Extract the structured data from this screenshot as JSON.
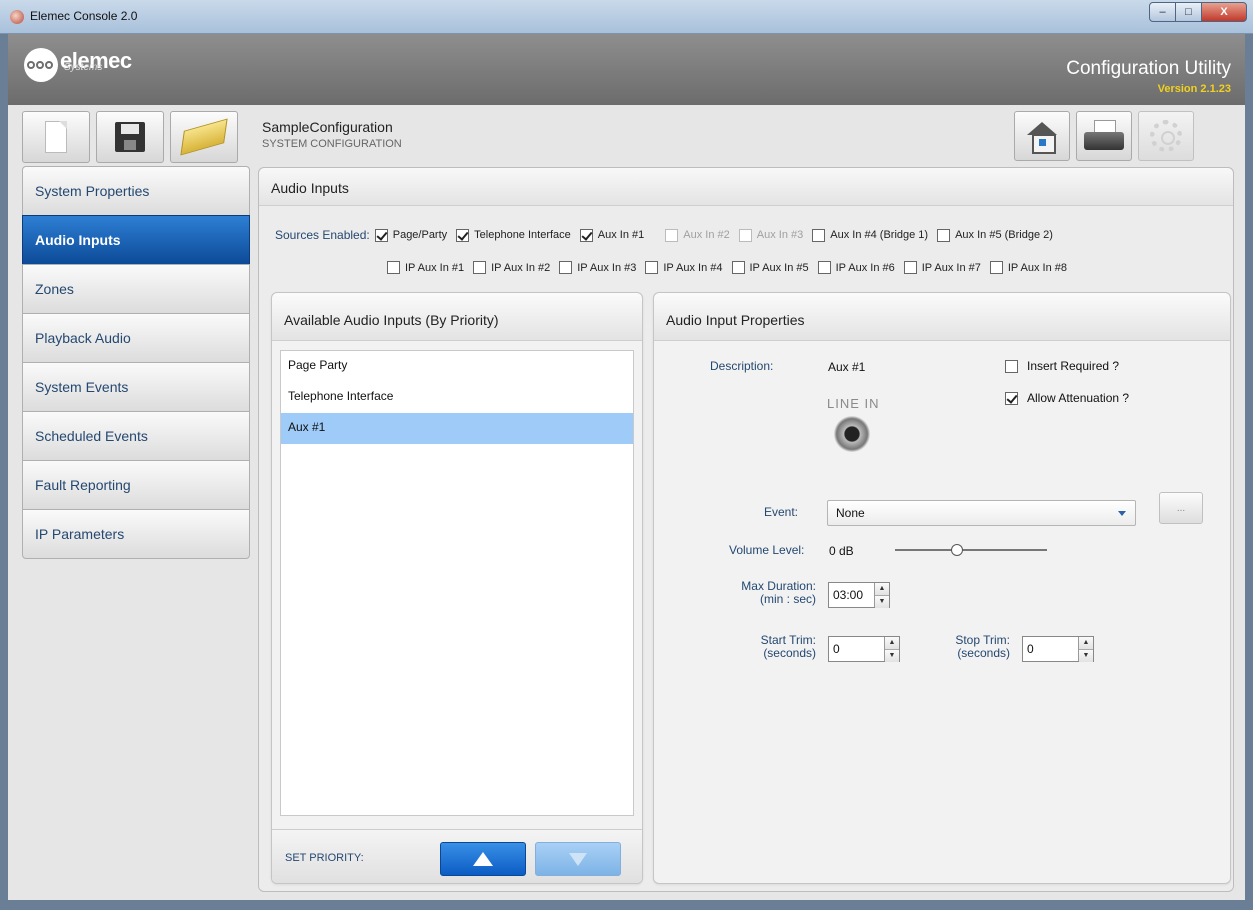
{
  "window": {
    "title": "Elemec Console 2.0",
    "controls": {
      "minimize": "–",
      "maximize": "□",
      "close": "X"
    }
  },
  "banner": {
    "logo_text": "elemec",
    "logo_sub": "Systems",
    "title": "Configuration Utility",
    "version": "Version 2.1.23"
  },
  "toolbar": {
    "left_buttons": [
      "new-document-icon",
      "save-icon",
      "open-folder-icon"
    ],
    "right_buttons": [
      "home-icon",
      "printer-icon",
      "gear-icon"
    ]
  },
  "config": {
    "name": "SampleConfiguration",
    "subtitle": "SYSTEM CONFIGURATION"
  },
  "sidebar": {
    "items": [
      {
        "label": "System Properties",
        "active": false
      },
      {
        "label": "Audio Inputs",
        "active": true
      },
      {
        "label": "Zones",
        "active": false
      },
      {
        "label": "Playback Audio",
        "active": false
      },
      {
        "label": "System Events",
        "active": false
      },
      {
        "label": "Scheduled Events",
        "active": false
      },
      {
        "label": "Fault Reporting",
        "active": false
      },
      {
        "label": "IP Parameters",
        "active": false
      }
    ]
  },
  "main": {
    "title": "Audio Inputs",
    "sources_label": "Sources Enabled:",
    "sources_row1": [
      {
        "label": "Page/Party",
        "checked": true,
        "enabled": true
      },
      {
        "label": "Telephone Interface",
        "checked": true,
        "enabled": true
      },
      {
        "label": "Aux In #1",
        "checked": true,
        "enabled": true
      },
      {
        "label": "Aux In #2",
        "checked": false,
        "enabled": false
      },
      {
        "label": "Aux In #3",
        "checked": false,
        "enabled": false
      },
      {
        "label": "Aux In #4 (Bridge 1)",
        "checked": false,
        "enabled": true
      },
      {
        "label": "Aux In #5 (Bridge 2)",
        "checked": false,
        "enabled": true
      }
    ],
    "sources_row2": [
      {
        "label": "IP Aux In #1",
        "checked": false
      },
      {
        "label": "IP Aux In #2",
        "checked": false
      },
      {
        "label": "IP Aux In #3",
        "checked": false
      },
      {
        "label": "IP Aux In #4",
        "checked": false
      },
      {
        "label": "IP Aux In #5",
        "checked": false
      },
      {
        "label": "IP Aux In #6",
        "checked": false
      },
      {
        "label": "IP Aux In #7",
        "checked": false
      },
      {
        "label": "IP Aux In #8",
        "checked": false
      }
    ]
  },
  "inputs_panel": {
    "title": "Available Audio Inputs (By Priority)",
    "items": [
      {
        "label": "Page Party",
        "selected": false
      },
      {
        "label": "Telephone Interface",
        "selected": false
      },
      {
        "label": "Aux #1",
        "selected": true
      }
    ],
    "priority_label": "SET PRIORITY:"
  },
  "props_panel": {
    "title": "Audio Input Properties",
    "description_label": "Description:",
    "description_value": "Aux #1",
    "insert_required_label": "Insert Required ?",
    "insert_required": false,
    "allow_attenuation_label": "Allow Attenuation ?",
    "allow_attenuation": true,
    "line_in_label": "LINE IN",
    "event_label": "Event:",
    "event_value": "None",
    "ellipsis": "...",
    "volume_label": "Volume Level:",
    "volume_value": "0 dB",
    "volume_fraction": 0.42,
    "max_duration_label": "Max Duration:",
    "max_duration_unit": "(min : sec)",
    "max_duration_value": "03:00",
    "start_trim_label": "Start Trim:",
    "start_trim_unit": "(seconds)",
    "start_trim_value": "0",
    "stop_trim_label": "Stop Trim:",
    "stop_trim_unit": "(seconds)",
    "stop_trim_value": "0"
  },
  "colors": {
    "accent": "#0d4a98",
    "label_blue": "#244870",
    "version_yellow": "#f0d020",
    "selection": "#9ecbf7"
  }
}
